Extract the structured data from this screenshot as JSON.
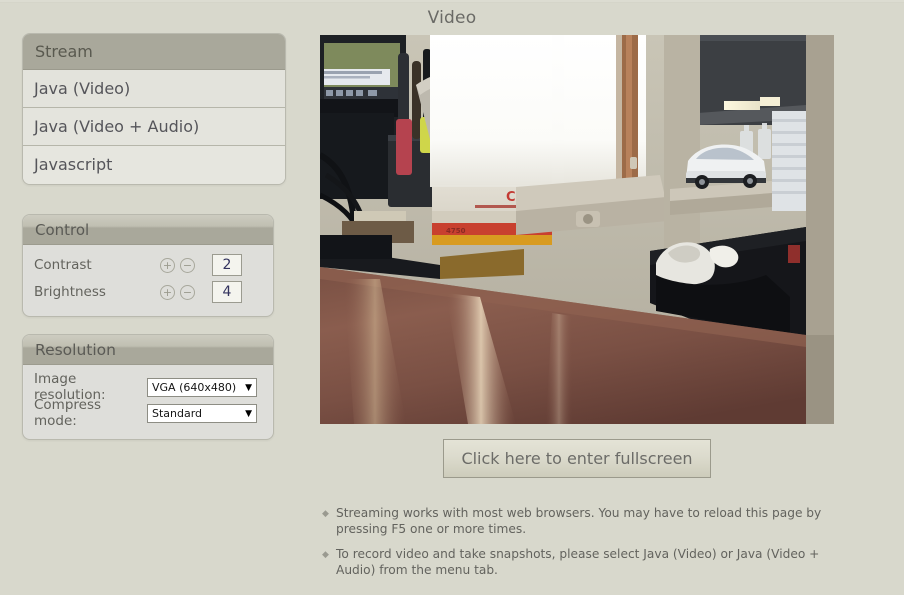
{
  "page": {
    "title": "Video",
    "background_color": "#d8d8cc"
  },
  "stream_menu": {
    "header": "Stream",
    "items": [
      {
        "label": "Java (Video)"
      },
      {
        "label": "Java (Video + Audio)"
      },
      {
        "label": "Javascript"
      }
    ]
  },
  "control_panel": {
    "header": "Control",
    "rows": [
      {
        "label": "Contrast",
        "increase": "+",
        "decrease": "−",
        "value": "2"
      },
      {
        "label": "Brightness",
        "increase": "+",
        "decrease": "−",
        "value": "4"
      }
    ]
  },
  "resolution_panel": {
    "header": "Resolution",
    "rows": [
      {
        "label": "Image resolution:",
        "value": "VGA (640x480)",
        "arrow": "▼"
      },
      {
        "label": "Compress mode:",
        "value": "Standard",
        "arrow": "▼"
      }
    ]
  },
  "video": {
    "alt": "live-camera-view-of-office-desk-window-and-model-car"
  },
  "fullscreen_button": {
    "label": "Click here to enter fullscreen"
  },
  "notes": {
    "bullet": "◆",
    "items": [
      "Streaming works with most web browsers. You may have to reload this page by pressing F5 one or more times.",
      "To record video and take snapshots, please select Java (Video) or Java (Video + Audio) from the menu tab."
    ]
  }
}
